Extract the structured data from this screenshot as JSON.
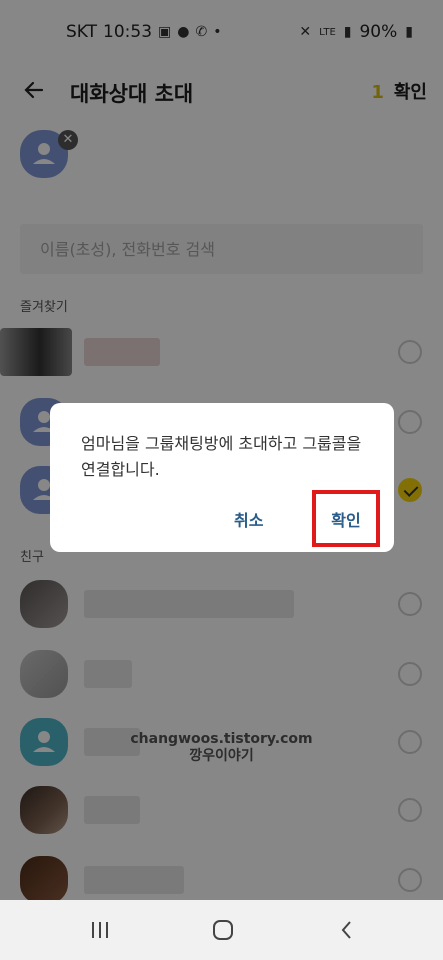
{
  "status": {
    "carrier": "SKT",
    "time": "10:53",
    "battery": "90%",
    "network": "LTE"
  },
  "header": {
    "title": "대화상대 초대",
    "selected_count": "1",
    "confirm_label": "확인"
  },
  "search": {
    "placeholder": "이름(초성), 전화번호 검색"
  },
  "sections": {
    "favorites": "즐겨찾기",
    "friends": "친구"
  },
  "watermark": {
    "line1": "changwoos.tistory.com",
    "line2": "깡우이야기"
  },
  "dialog": {
    "message": "엄마님을 그룹채팅방에 초대하고 그룹콜을 연결합니다.",
    "cancel_label": "취소",
    "ok_label": "확인"
  },
  "icons": {
    "back": "arrow-left-icon",
    "remove": "close-icon",
    "check": "check-icon",
    "nav_recent": "recent-apps-icon",
    "nav_home": "home-icon",
    "nav_back": "back-icon"
  },
  "colors": {
    "accent": "#f6d30e",
    "highlight_box": "#e01a1a",
    "dialog_button": "#2a5d8a"
  }
}
